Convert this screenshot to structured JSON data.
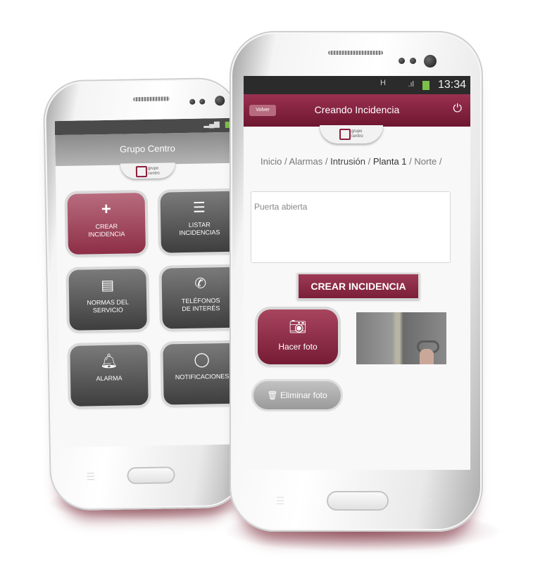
{
  "back_phone": {
    "app_title": "Grupo Centro",
    "menu": [
      {
        "label_line1": "CREAR",
        "label_line2": "INCIDENCIA",
        "icon": "plus-icon"
      },
      {
        "label_line1": "LISTAR",
        "label_line2": "INCIDENCIAS",
        "icon": "list-icon"
      },
      {
        "label_line1": "NORMAS DEL",
        "label_line2": "SERVICIO",
        "icon": "document-icon"
      },
      {
        "label_line1": "TELÉFONOS",
        "label_line2": "DE INTERÉS",
        "icon": "phone-icon"
      },
      {
        "label_line1": "ALARMA",
        "label_line2": "",
        "icon": "bell-icon"
      },
      {
        "label_line1": "NOTIFICACIONES",
        "label_line2": "",
        "icon": "chat-icon"
      }
    ],
    "logo_text_1": "grupo",
    "logo_text_2": "centro"
  },
  "front_phone": {
    "status_time": "13:34",
    "back_label": "Volver",
    "title": "Creando Incidencia",
    "logo_text_1": "grupo",
    "logo_text_2": "centro",
    "breadcrumb": {
      "items": [
        "Inicio",
        "Alarmas",
        "Intrusión",
        "Planta 1",
        "Norte"
      ],
      "separator": "/"
    },
    "description_value": "Puerta abierta",
    "create_button": "CREAR INCIDENCIA",
    "take_photo": "Hacer foto",
    "delete_photo": "Eliminar foto"
  },
  "colors": {
    "brand_maroon": "#8b1d3a",
    "header_maroon": "#7e1d36",
    "dark_button": "#4a4a4a",
    "delete_button": "#b5b5b5"
  }
}
